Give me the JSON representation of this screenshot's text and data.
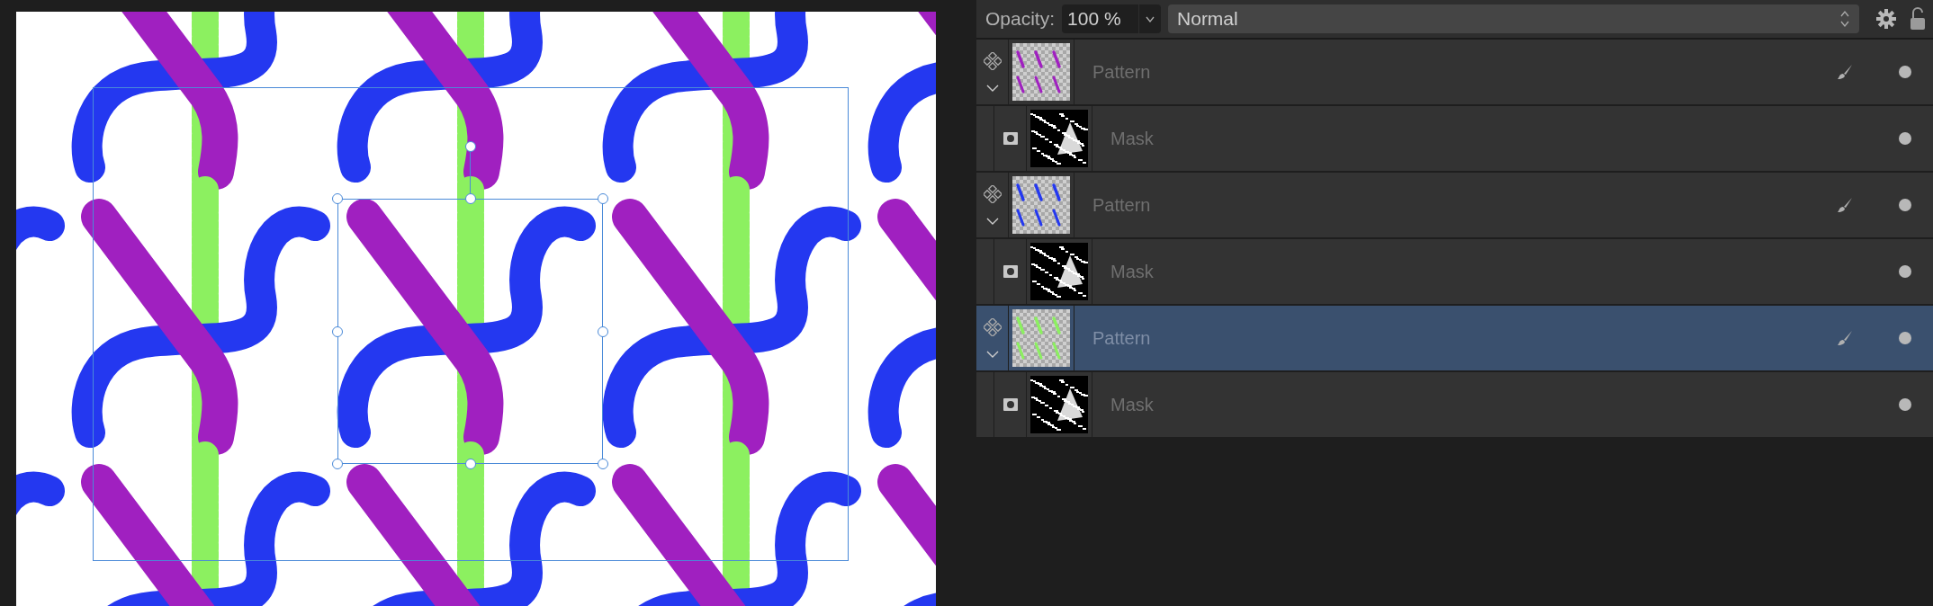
{
  "properties_bar": {
    "opacity_label": "Opacity:",
    "opacity_value": "100 %",
    "blend_mode": "Normal"
  },
  "layers": [
    {
      "name": "Pattern",
      "selected": false,
      "expanded": true,
      "color": "#a020c0",
      "children": [
        {
          "name": "Mask"
        }
      ]
    },
    {
      "name": "Pattern",
      "selected": false,
      "expanded": true,
      "color": "#2438f0",
      "children": [
        {
          "name": "Mask"
        }
      ]
    },
    {
      "name": "Pattern",
      "selected": true,
      "expanded": true,
      "color": "#8cf060",
      "children": [
        {
          "name": "Mask"
        }
      ]
    }
  ]
}
